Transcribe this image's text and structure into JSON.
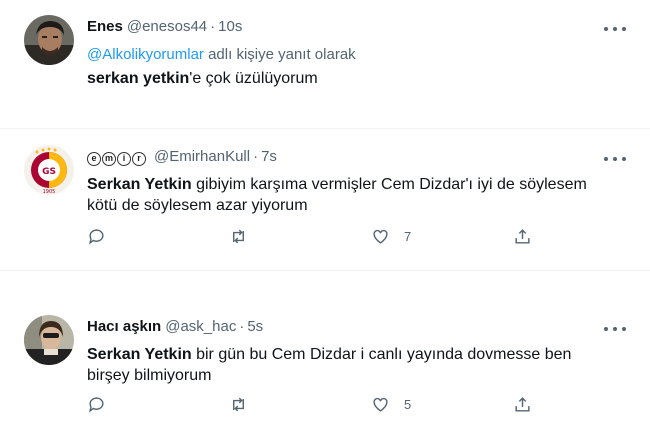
{
  "tweets": [
    {
      "name": "Enes",
      "handle": "@enesos44",
      "time": "10s",
      "reply_prefix": "@Alkolikyorumlar",
      "reply_suffix": "adlı kişiye yanıt olarak",
      "mention": "serkan yetkin",
      "text": "'e çok üzülüyorum",
      "avatar_icon": "man-portrait-avatar"
    },
    {
      "name_letters": [
        "e",
        "m",
        "i",
        "r"
      ],
      "handle": "@EmirhanKull",
      "time": "7s",
      "mention": "Serkan Yetkin",
      "text": " gibiyim karşıma vermişler Cem Dizdar'ı iyi de söylesem kötü de söylesem azar yiyorum",
      "like_count": "7",
      "avatar_icon": "galatasaray-crest-avatar",
      "emblem_text": "1905"
    },
    {
      "name": "Hacı aşkın",
      "handle": "@ask_hac",
      "time": "5s",
      "mention": "Serkan Yetkin",
      "text": " bir gün bu Cem Dizdar i canlı yayında dovmesse ben birşey bilmiyorum",
      "like_count": "5",
      "avatar_icon": "woman-portrait-avatar"
    }
  ],
  "separator": "·",
  "colors": {
    "text_primary": "#0f1419",
    "text_secondary": "#536471",
    "link": "#1d9bf0",
    "divider": "#eff3f4",
    "galatasaray_red": "#a90432",
    "galatasaray_yellow": "#fdb912"
  }
}
